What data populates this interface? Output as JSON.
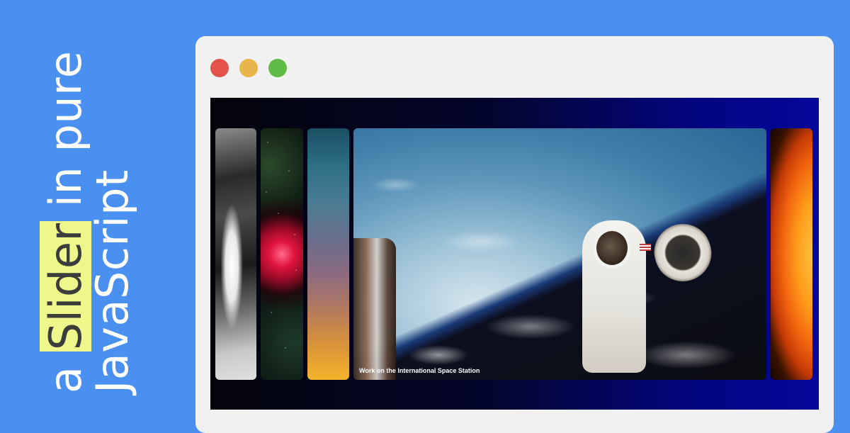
{
  "banner": {
    "title_prefix": "a",
    "title_highlight": "Slider",
    "title_suffix": "in pure",
    "title_line2": "JavaScript",
    "colors": {
      "background": "#4a90f0",
      "highlight": "#eef78a"
    }
  },
  "window": {
    "controls": [
      "close",
      "minimize",
      "maximize"
    ],
    "colors": {
      "close": "#e4534b",
      "minimize": "#e7b64a",
      "maximize": "#5dbb46"
    }
  },
  "slider": {
    "slides": [
      {
        "image": "spacecraft-interior"
      },
      {
        "image": "rosette-nebula"
      },
      {
        "image": "milky-way"
      },
      {
        "image": "astronaut-spacewalk",
        "caption": "Work on the International Space Station",
        "active": true
      },
      {
        "image": "sun"
      }
    ]
  }
}
